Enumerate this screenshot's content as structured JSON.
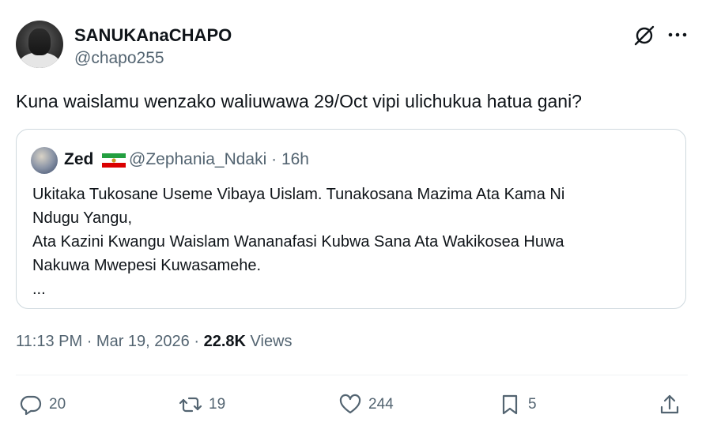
{
  "author": {
    "name": "SANUKAnaCHAPO",
    "handle": "@chapo255"
  },
  "tweet": {
    "text": "Kuna waislamu wenzako waliuwawa 29/Oct vipi ulichukua hatua gani?"
  },
  "quoted": {
    "name": "Zed",
    "handle": "@Zephania_Ndaki",
    "separator": "·",
    "age": "16h",
    "lines": [
      "Ukitaka Tukosane Useme Vibaya Uislam.  Tunakosana Mazima Ata Kama Ni",
      "Ndugu Yangu,",
      "Ata Kazini Kwangu Waislam Wananafasi Kubwa Sana Ata Wakikosea Huwa",
      "Nakuwa Mwepesi Kuwasamehe.",
      "..."
    ]
  },
  "meta": {
    "time": "11:13 PM",
    "dot1": "·",
    "date": "Mar 19, 2026",
    "dot2": "·",
    "views_count": "22.8K",
    "views_label": "Views"
  },
  "actions": {
    "replies": "20",
    "reposts": "19",
    "likes": "244",
    "bookmarks": "5"
  },
  "icons": {
    "grok": "grok-icon",
    "more": "more-icon",
    "reply": "reply-icon",
    "repost": "repost-icon",
    "like": "heart-icon",
    "bookmark": "bookmark-icon",
    "share": "share-icon"
  },
  "colors": {
    "text": "#0f1419",
    "secondary": "#536471",
    "border": "#cfd9de"
  }
}
